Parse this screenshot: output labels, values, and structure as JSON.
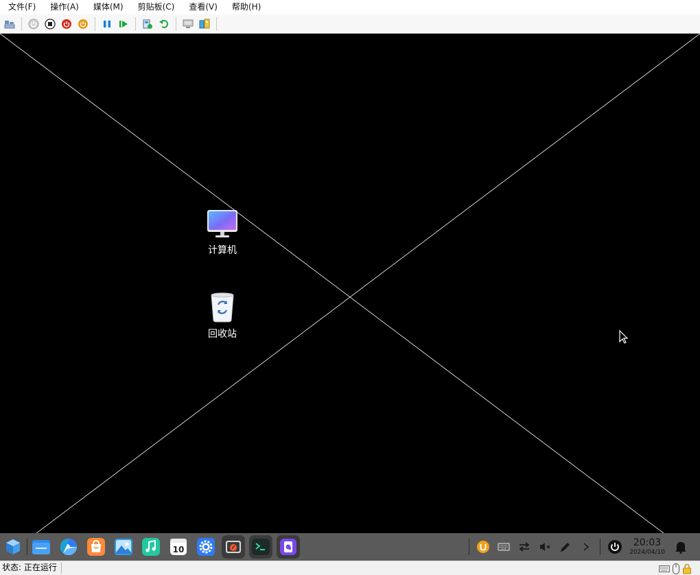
{
  "menu": [
    {
      "label": "文件(F)"
    },
    {
      "label": "操作(A)"
    },
    {
      "label": "媒体(M)"
    },
    {
      "label": "剪贴板(C)"
    },
    {
      "label": "查看(V)"
    },
    {
      "label": "帮助(H)"
    }
  ],
  "toolbar": {
    "buttons": [
      "ctrl-alt-del-icon",
      "start-icon",
      "turn-off-icon",
      "shutdown-icon",
      "save-icon",
      "pause-icon",
      "reset-icon",
      "checkpoint-icon",
      "revert-icon",
      "enhanced-session-icon",
      "share-icon"
    ]
  },
  "desktop": {
    "icons": [
      {
        "label": "计算机",
        "icon": "computer-icon"
      },
      {
        "label": "回收站",
        "icon": "trash-icon"
      }
    ]
  },
  "taskbar": {
    "apps": [
      "launcher-icon",
      "file-manager-icon",
      "browser-icon",
      "app-store-icon",
      "image-viewer-icon",
      "music-icon",
      "calendar-icon",
      "settings-icon",
      "screen-recorder-icon",
      "terminal-icon",
      "deepin-tool-icon"
    ],
    "calendar_day": "10",
    "tray": [
      "uos-id-icon",
      "keyboard-icon",
      "network-icon",
      "volume-muted-icon",
      "pen-icon",
      "expand-icon",
      "power-icon"
    ],
    "clock": {
      "time": "20:03",
      "date": "2024/04/10"
    },
    "notification_icon": "bell-icon"
  },
  "status": {
    "text": "状态: 正在运行",
    "icons": [
      "keyboard-status-icon",
      "mouse-status-icon",
      "lock-status-icon"
    ]
  },
  "colors": {
    "accent_blue": "#2e7cf6",
    "desktop_bg": "#000000",
    "taskbar_bg": "#5a5a5a"
  }
}
